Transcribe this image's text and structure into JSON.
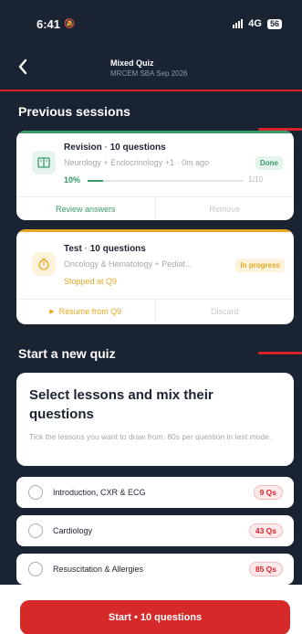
{
  "status": {
    "time": "6:41",
    "network": "4G",
    "battery": "56"
  },
  "nav": {
    "title": "Mixed Quiz",
    "subtitle": "MRCEM SBA Sep 2026"
  },
  "previous": {
    "heading": "Previous sessions",
    "sessions": [
      {
        "title": "Revision",
        "count_label": "10 questions",
        "topics": "Neurology + Endocrinology +1",
        "time_ago": "0m ago",
        "status": "Done",
        "progress_label": "10%",
        "progress_value": 0.1,
        "progress_count": "1/10",
        "primary_action": "Review answers",
        "secondary_action": "Remove"
      },
      {
        "title": "Test",
        "count_label": "10 questions",
        "topics": "Oncology & Hematology + Pediat...",
        "status": "In progress",
        "stopped_label": "Stopped at Q9",
        "primary_action": "Resume from Q9",
        "secondary_action": "Discard"
      }
    ]
  },
  "new_quiz": {
    "heading": "Start a new quiz",
    "title": "Select lessons and mix their questions",
    "description": "Tick the lessons you want to draw from. 80s per question in test mode.",
    "lessons": [
      {
        "label": "Introduction, CXR & ECG",
        "count": "9 Qs"
      },
      {
        "label": "Cardiology",
        "count": "43 Qs"
      },
      {
        "label": "Resuscitation & Allergies",
        "count": "85 Qs"
      }
    ]
  },
  "start_button": "Start • 10 questions",
  "colors": {
    "background": "#1a2332",
    "accent_red": "#d8232a",
    "done_green": "#3a9a6a",
    "in_progress_amber": "#e6a823"
  }
}
